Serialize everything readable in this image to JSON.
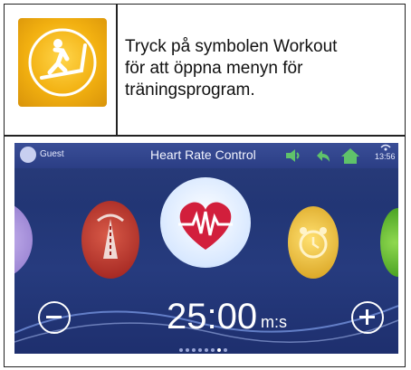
{
  "instruction": {
    "lines": [
      "Tryck på symbolen Workout",
      "för att öppna menyn för",
      "träningsprogram."
    ]
  },
  "screen": {
    "user": "Guest",
    "title": "Heart Rate Control",
    "clock": "13:56",
    "time_value": "25:00",
    "time_unit": "m:s",
    "page_dots": 8,
    "active_dot": 7
  }
}
